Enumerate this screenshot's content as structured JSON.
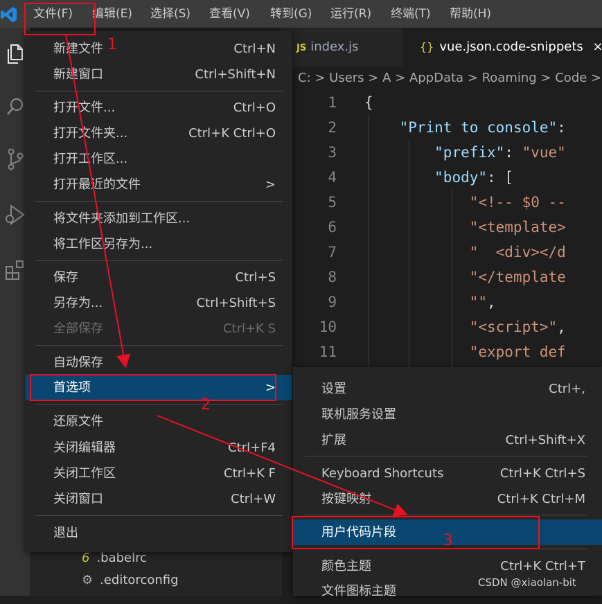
{
  "menubar": {
    "items": [
      "文件(F)",
      "编辑(E)",
      "选择(S)",
      "查看(V)",
      "转到(G)",
      "运行(R)",
      "终端(T)",
      "帮助(H)"
    ]
  },
  "activity_icons": [
    "files-icon",
    "search-icon",
    "source-control-icon",
    "run-debug-icon",
    "extensions-icon"
  ],
  "tabs": [
    {
      "icon": "JS",
      "label": "index.js"
    },
    {
      "icon": "{}",
      "label": "vue.json.code-snippets",
      "close": "×"
    }
  ],
  "breadcrumb": "C: > Users > A > AppData > Roaming > Code > Us",
  "editor": {
    "line_numbers": [
      "1",
      "2",
      "3",
      "4",
      "5",
      "6",
      "7",
      "8",
      "9",
      "10",
      "11"
    ]
  },
  "file_menu": {
    "items": [
      {
        "label": "新建文件",
        "shortcut": "Ctrl+N"
      },
      {
        "label": "新建窗口",
        "shortcut": "Ctrl+Shift+N"
      },
      {
        "label": "打开文件...",
        "shortcut": "Ctrl+O"
      },
      {
        "label": "打开文件夹...",
        "shortcut": "Ctrl+K Ctrl+O"
      },
      {
        "label": "打开工作区...",
        "shortcut": ""
      },
      {
        "label": "打开最近的文件",
        "shortcut": ">"
      },
      {
        "label": "将文件夹添加到工作区...",
        "shortcut": ""
      },
      {
        "label": "将工作区另存为...",
        "shortcut": ""
      },
      {
        "label": "保存",
        "shortcut": "Ctrl+S"
      },
      {
        "label": "另存为...",
        "shortcut": "Ctrl+Shift+S"
      },
      {
        "label": "全部保存",
        "shortcut": "Ctrl+K S"
      },
      {
        "label": "自动保存",
        "shortcut": ""
      },
      {
        "label": "首选项",
        "shortcut": ">"
      },
      {
        "label": "还原文件",
        "shortcut": ""
      },
      {
        "label": "关闭编辑器",
        "shortcut": "Ctrl+F4"
      },
      {
        "label": "关闭工作区",
        "shortcut": "Ctrl+K F"
      },
      {
        "label": "关闭窗口",
        "shortcut": "Ctrl+W"
      },
      {
        "label": "退出",
        "shortcut": ""
      }
    ]
  },
  "pref_menu": {
    "items": [
      {
        "label": "设置",
        "shortcut": "Ctrl+,"
      },
      {
        "label": "联机服务设置",
        "shortcut": ""
      },
      {
        "label": "扩展",
        "shortcut": "Ctrl+Shift+X"
      },
      {
        "label": "Keyboard Shortcuts",
        "shortcut": "Ctrl+K Ctrl+S"
      },
      {
        "label": "按键映射",
        "shortcut": "Ctrl+K Ctrl+M"
      },
      {
        "label": "用户代码片段",
        "shortcut": ""
      },
      {
        "label": "颜色主题",
        "shortcut": "Ctrl+K Ctrl+T"
      },
      {
        "label": "文件图标主题",
        "shortcut": ""
      }
    ]
  },
  "explorer_files": [
    {
      "icon": "6",
      "name": ".babelrc"
    },
    {
      "icon": "gear",
      "name": ".editorconfig"
    }
  ],
  "annotations": [
    "1",
    "2",
    "3"
  ],
  "watermark": "CSDN @xiaolan-bit",
  "colors": {
    "menu_bg": "#252526",
    "highlight": "#094771",
    "annotation": "#e81123"
  }
}
